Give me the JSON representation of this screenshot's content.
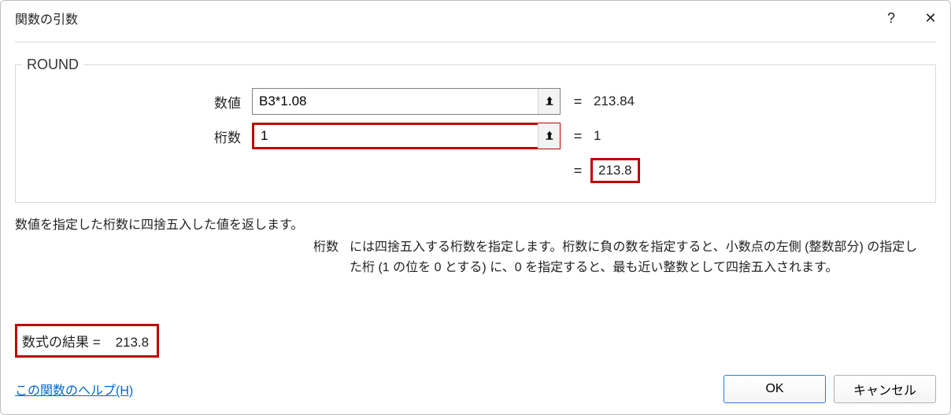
{
  "window": {
    "title": "関数の引数",
    "help_glyph": "?",
    "close_glyph": "✕"
  },
  "function_name": "ROUND",
  "args": [
    {
      "label": "数値",
      "value": "B3*1.08",
      "result": "213.84",
      "highlighted": false
    },
    {
      "label": "桁数",
      "value": "1",
      "result": "1",
      "highlighted": true
    }
  ],
  "preview": {
    "eq": "=",
    "value": "213.8"
  },
  "description": "数値を指定した桁数に四捨五入した値を返します。",
  "arg_help": {
    "label": "桁数",
    "text": "には四捨五入する桁数を指定します。桁数に負の数を指定すると、小数点の左側 (整数部分) の指定した桁 (1 の位を 0 とする) に、0 を指定すると、最も近い整数として四捨五入されます。"
  },
  "formula_result": {
    "label": "数式の結果 =",
    "value": "213.8"
  },
  "help_link": "この関数のヘルプ(H)",
  "buttons": {
    "ok": "OK",
    "cancel": "キャンセル"
  }
}
